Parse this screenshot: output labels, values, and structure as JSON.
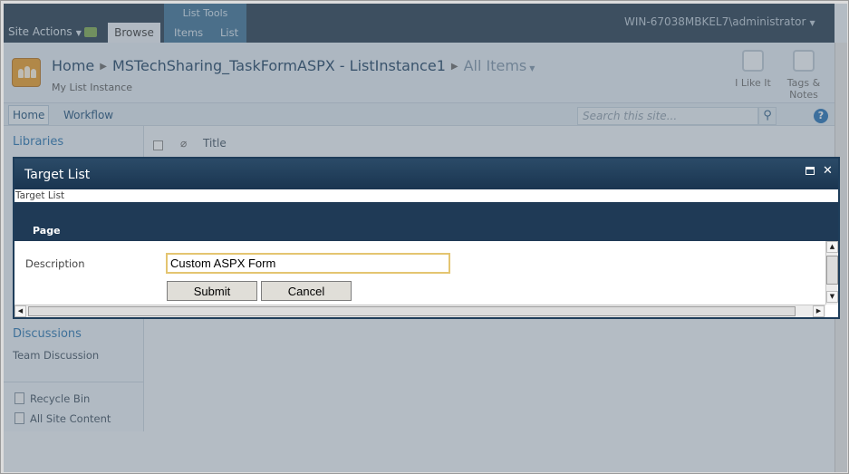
{
  "ribbon": {
    "site_actions": "Site Actions",
    "browse_tab": "Browse",
    "list_tools_label": "List Tools",
    "items_tab": "Items",
    "list_tab": "List",
    "user": "WIN-67038MBKEL7\\administrator"
  },
  "title_area": {
    "breadcrumb_home": "Home",
    "breadcrumb_list": "MSTechSharing_TaskFormASPX - ListInstance1",
    "breadcrumb_view": "All Items",
    "subtitle": "My List Instance",
    "i_like_it": "I Like It",
    "tags_notes_1": "Tags &",
    "tags_notes_2": "Notes"
  },
  "topnav": {
    "home": "Home",
    "workflow": "Workflow",
    "search_placeholder": "Search this site...",
    "help": "?"
  },
  "leftnav": {
    "libraries": "Libraries",
    "discussions": "Discussions",
    "team_discussion": "Team Discussion",
    "recycle_bin": "Recycle Bin",
    "all_site_content": "All Site Content"
  },
  "list": {
    "title_column": "Title"
  },
  "dialog": {
    "title": "Target List",
    "page_title": "Target List",
    "tab_page": "Page",
    "description_label": "Description",
    "description_value": "Custom ASPX Form",
    "submit_label": "Submit",
    "cancel_label": "Cancel"
  },
  "colors": {
    "ribbon_dark": "#21374c",
    "list_tools": "#3a6f94",
    "link_blue": "#2371ae",
    "dialog_header": "#1f3a56",
    "input_focus_border": "#e4c571"
  }
}
